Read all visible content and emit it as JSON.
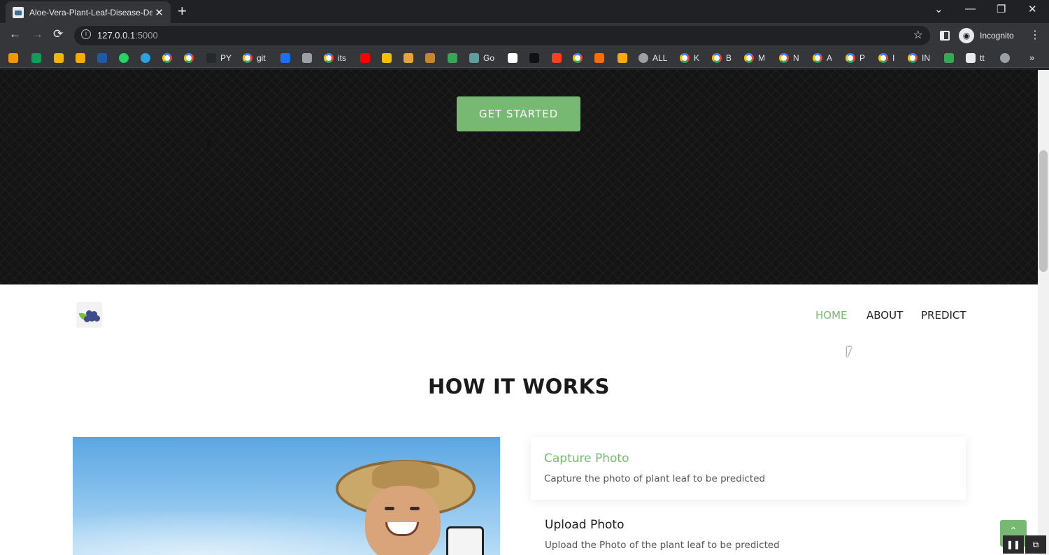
{
  "browser": {
    "tab_title": "Aloe-Vera-Plant-Leaf-Disease-De",
    "tab_close": "✕",
    "new_tab": "+",
    "url_host": "127.0.0.1",
    "url_port": ":5000",
    "profile_label": "Incognito",
    "window_controls": [
      "⌄",
      "—",
      "❐",
      "✕"
    ],
    "nav": {
      "back": "←",
      "forward": "→",
      "reload": "⟳"
    },
    "star": "☆",
    "menu": "⋮"
  },
  "bookmarks": {
    "items": [
      {
        "icon": "generic-icon",
        "color": "#f29900",
        "label": ""
      },
      {
        "icon": "sheets-icon",
        "color": "#0f9d58",
        "label": ""
      },
      {
        "icon": "generic-icon",
        "color": "#f4b400",
        "label": ""
      },
      {
        "icon": "analytics-icon",
        "color": "#f9ab00",
        "label": ""
      },
      {
        "icon": "ieee-icon",
        "color": "#1e5aa8",
        "label": ""
      },
      {
        "icon": "whatsapp-icon",
        "color": "#25d366",
        "label": ""
      },
      {
        "icon": "telegram-icon",
        "color": "#2aa3df",
        "label": ""
      },
      {
        "icon": "google-icon",
        "color": "",
        "label": ""
      },
      {
        "icon": "google-icon",
        "color": "",
        "label": ""
      },
      {
        "icon": "github-icon",
        "color": "#24292e",
        "label": "PY"
      },
      {
        "icon": "google-icon",
        "color": "",
        "label": "git"
      },
      {
        "icon": "generic-icon",
        "color": "#1a73e8",
        "label": ""
      },
      {
        "icon": "generic-icon",
        "color": "#9aa0a6",
        "label": ""
      },
      {
        "icon": "google-icon",
        "color": "",
        "label": "its"
      },
      {
        "icon": "youtube-icon",
        "color": "#ff0000",
        "label": ""
      },
      {
        "icon": "generic-icon",
        "color": "#fbbc04",
        "label": ""
      },
      {
        "icon": "generic-icon",
        "color": "#e8a33a",
        "label": ""
      },
      {
        "icon": "generic-icon",
        "color": "#c8862a",
        "label": ""
      },
      {
        "icon": "generic-icon",
        "color": "#34a853",
        "label": ""
      },
      {
        "icon": "generic-icon",
        "color": "#5f9ea0",
        "label": "Go"
      },
      {
        "icon": "generic-icon",
        "color": "#ffffff",
        "label": ""
      },
      {
        "icon": "generic-icon",
        "color": "#111111",
        "label": ""
      },
      {
        "icon": "yandex-icon",
        "color": "#fc3f1d",
        "label": ""
      },
      {
        "icon": "google-icon",
        "color": "",
        "label": ""
      },
      {
        "icon": "generic-icon",
        "color": "#ff6d00",
        "label": ""
      },
      {
        "icon": "generic-icon",
        "color": "#f9ab00",
        "label": ""
      },
      {
        "icon": "globe-icon",
        "color": "#9aa0a6",
        "label": "ALL"
      },
      {
        "icon": "google-icon",
        "color": "",
        "label": "K"
      },
      {
        "icon": "google-icon",
        "color": "",
        "label": "B"
      },
      {
        "icon": "google-icon",
        "color": "",
        "label": "M"
      },
      {
        "icon": "google-icon",
        "color": "",
        "label": "N"
      },
      {
        "icon": "google-icon",
        "color": "",
        "label": "A"
      },
      {
        "icon": "google-icon",
        "color": "",
        "label": "P"
      },
      {
        "icon": "google-icon",
        "color": "",
        "label": "I"
      },
      {
        "icon": "google-icon",
        "color": "",
        "label": "IN"
      },
      {
        "icon": "generic-icon",
        "color": "#34a853",
        "label": ""
      },
      {
        "icon": "monitor-icon",
        "color": "#e8eaed",
        "label": "tt"
      },
      {
        "icon": "globe-icon",
        "color": "#9aa0a6",
        "label": ""
      }
    ],
    "more": "»"
  },
  "page": {
    "cta_label": "GET STARTED",
    "nav": [
      {
        "label": "HOME",
        "active": true
      },
      {
        "label": "ABOUT",
        "active": false
      },
      {
        "label": "PREDICT",
        "active": false
      }
    ],
    "section_title": "HOW IT WORKS",
    "steps": [
      {
        "title": "Capture Photo",
        "desc": "Capture the photo of plant leaf to be predicted"
      },
      {
        "title": "Upload Photo",
        "desc": "Upload the Photo of the plant leaf to be predicted"
      }
    ],
    "back_to_top": "⌃",
    "media": {
      "pause": "❚❚",
      "pip": "⧉"
    }
  },
  "colors": {
    "accent_green": "#77b972",
    "hero_bg": "#141414",
    "browser_dark": "#202124",
    "browser_toolbar": "#35363a"
  }
}
